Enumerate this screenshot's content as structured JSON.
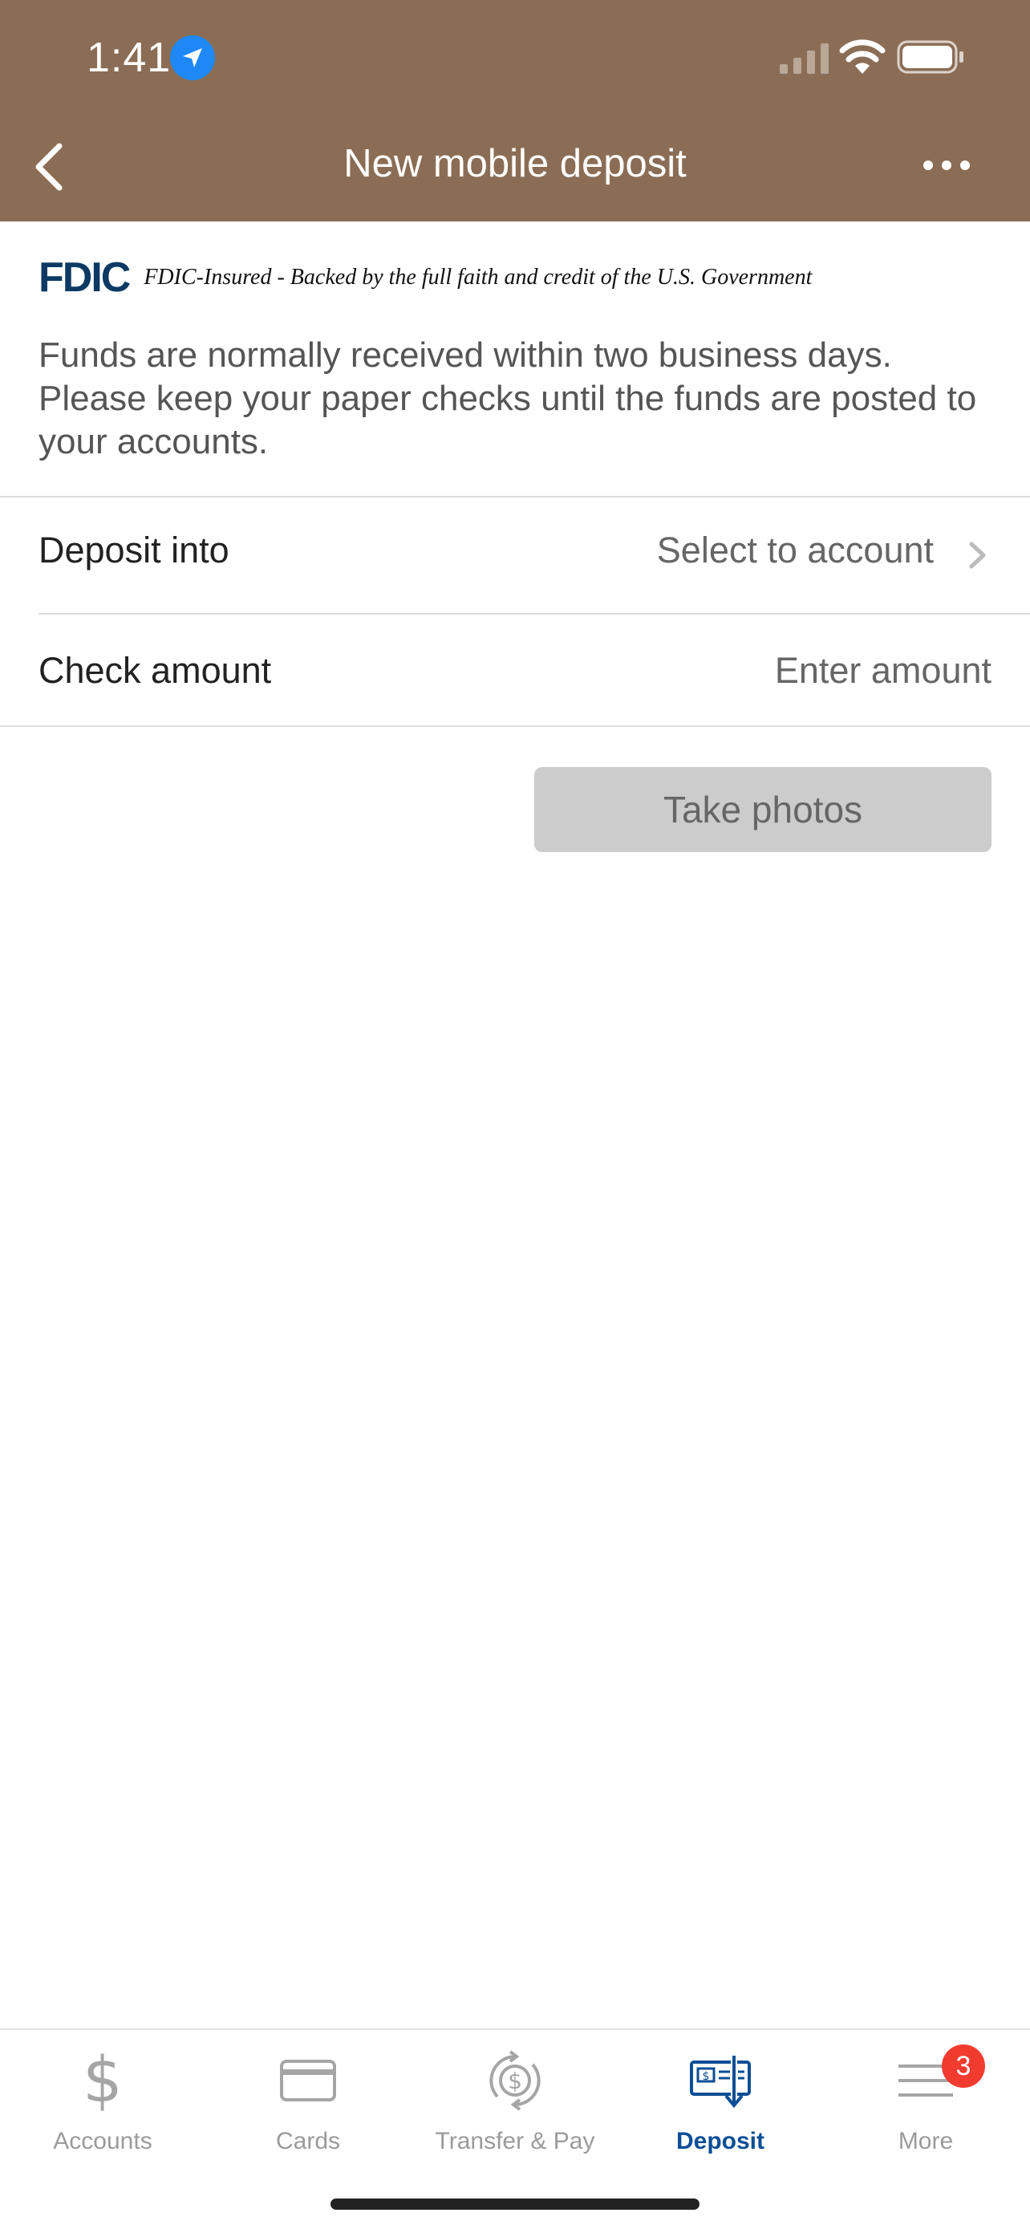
{
  "status_bar": {
    "time": "1:41"
  },
  "nav": {
    "title": "New mobile deposit"
  },
  "fdic": {
    "logo": "FDIC",
    "text": "FDIC-Insured - Backed by the full faith and credit of the U.S. Government"
  },
  "info": {
    "text": "Funds are normally received within two business days. Please keep your paper checks until the funds are posted to your accounts."
  },
  "form": {
    "deposit_into": {
      "label": "Deposit into",
      "value": "Select to account"
    },
    "check_amount": {
      "label": "Check amount",
      "placeholder": "Enter amount"
    }
  },
  "actions": {
    "take_photos": "Take photos"
  },
  "tabs": [
    {
      "label": "Accounts",
      "icon": "dollar-icon",
      "active": false
    },
    {
      "label": "Cards",
      "icon": "card-icon",
      "active": false
    },
    {
      "label": "Transfer & Pay",
      "icon": "transfer-pay-icon",
      "active": false
    },
    {
      "label": "Deposit",
      "icon": "deposit-check-icon",
      "active": true
    },
    {
      "label": "More",
      "icon": "menu-icon",
      "active": false,
      "badge": "3"
    }
  ],
  "colors": {
    "header": "#8B6D55",
    "accent": "#0A4E96",
    "badge": "#F23B2F",
    "location": "#1E88F7"
  }
}
